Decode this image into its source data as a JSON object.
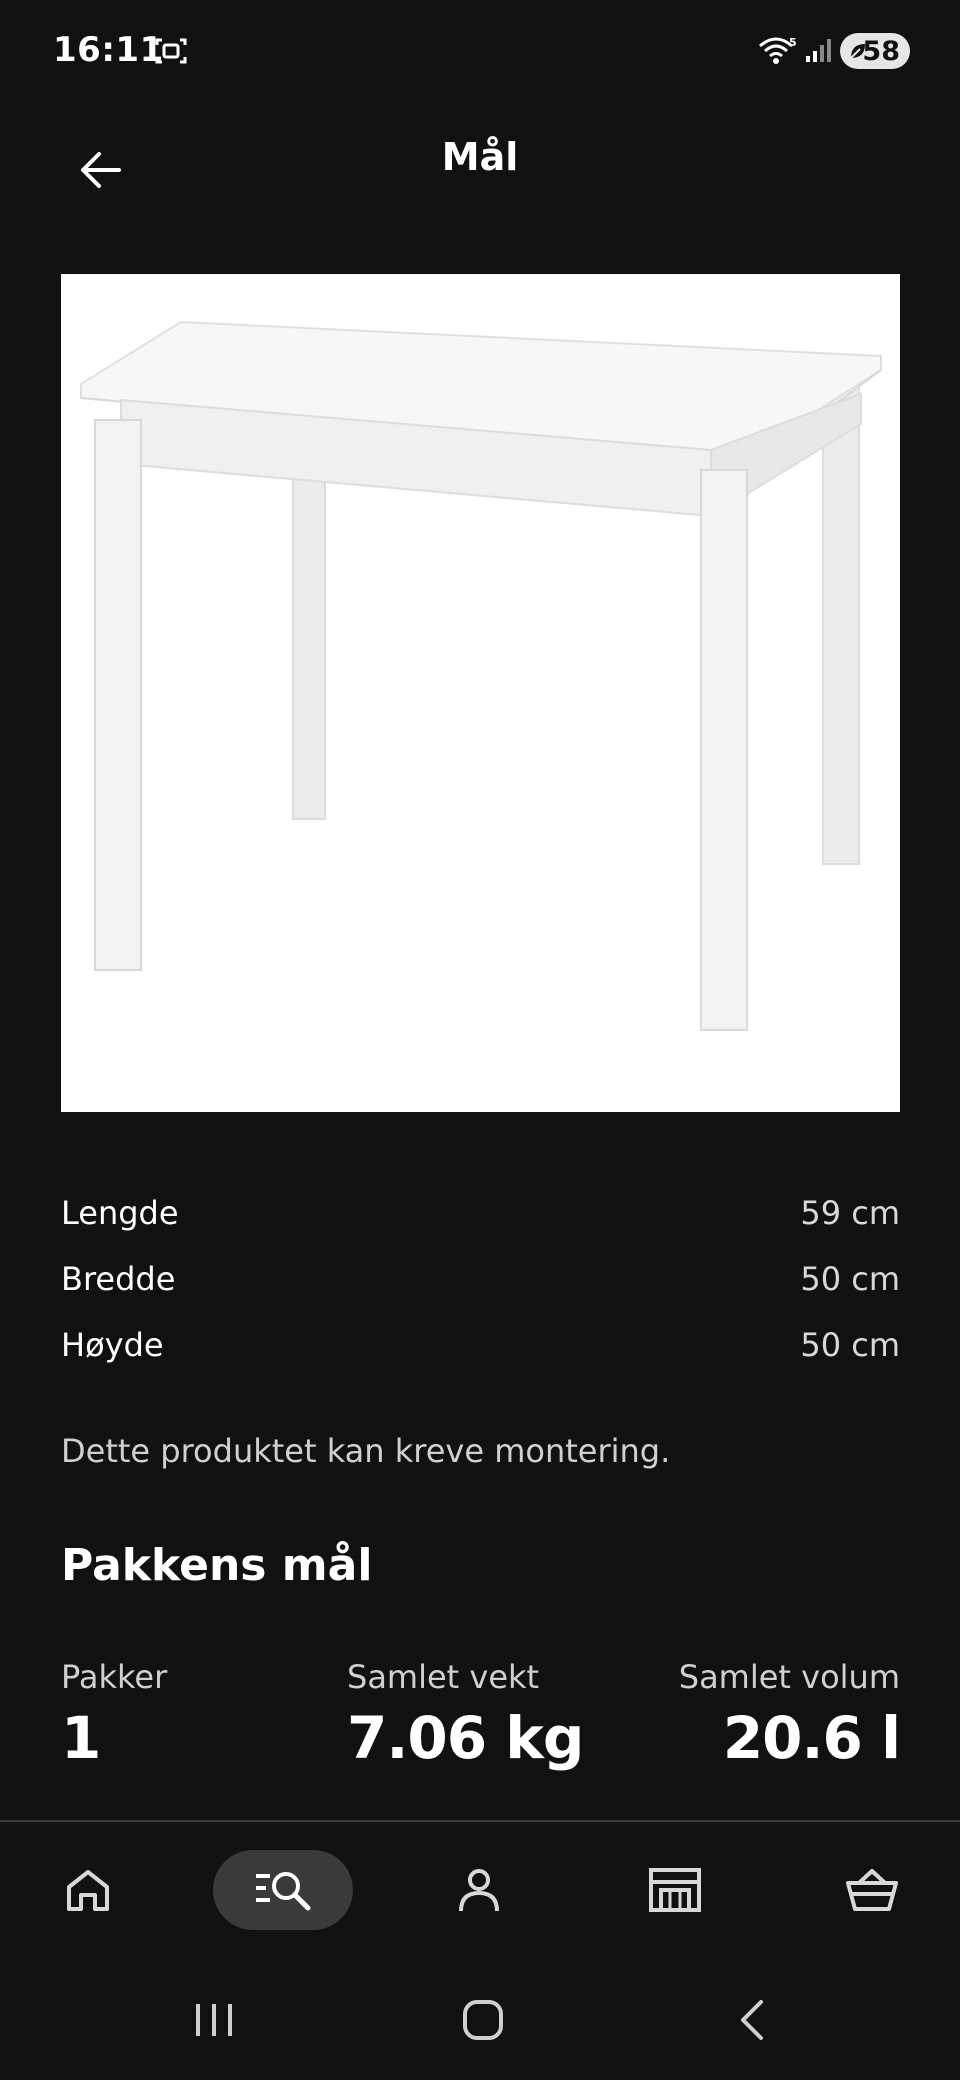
{
  "status_bar": {
    "time": "16:11",
    "battery": "58",
    "icons": [
      "screenshot-icon",
      "wifi-icon",
      "signal-icon",
      "battery-leaf-icon"
    ]
  },
  "header": {
    "title": "Mål",
    "back_icon": "arrow-left-icon"
  },
  "product": {
    "image_icon": "white-table-illustration"
  },
  "dimensions": [
    {
      "label": "Lengde",
      "value": "59 cm"
    },
    {
      "label": "Bredde",
      "value": "50 cm"
    },
    {
      "label": "Høyde",
      "value": "50 cm"
    }
  ],
  "assembly_note": "Dette produktet kan kreve montering.",
  "package": {
    "title": "Pakkens mål",
    "stats": [
      {
        "label": "Pakker",
        "value": "1"
      },
      {
        "label": "Samlet vekt",
        "value": "7.06 kg"
      },
      {
        "label": "Samlet volum",
        "value": "20.6 l"
      }
    ]
  },
  "bottom_nav": {
    "items": [
      "home-icon",
      "search-icon",
      "profile-icon",
      "store-icon",
      "basket-icon"
    ],
    "active": "search-icon"
  },
  "system_nav": {
    "items": [
      "recent-apps-icon",
      "home-button-icon",
      "back-chevron-icon"
    ]
  },
  "colors": {
    "background": "#111111",
    "text": "#ffffff",
    "muted_text": "#d0d0d0",
    "active_nav": "#3a3a3a"
  }
}
